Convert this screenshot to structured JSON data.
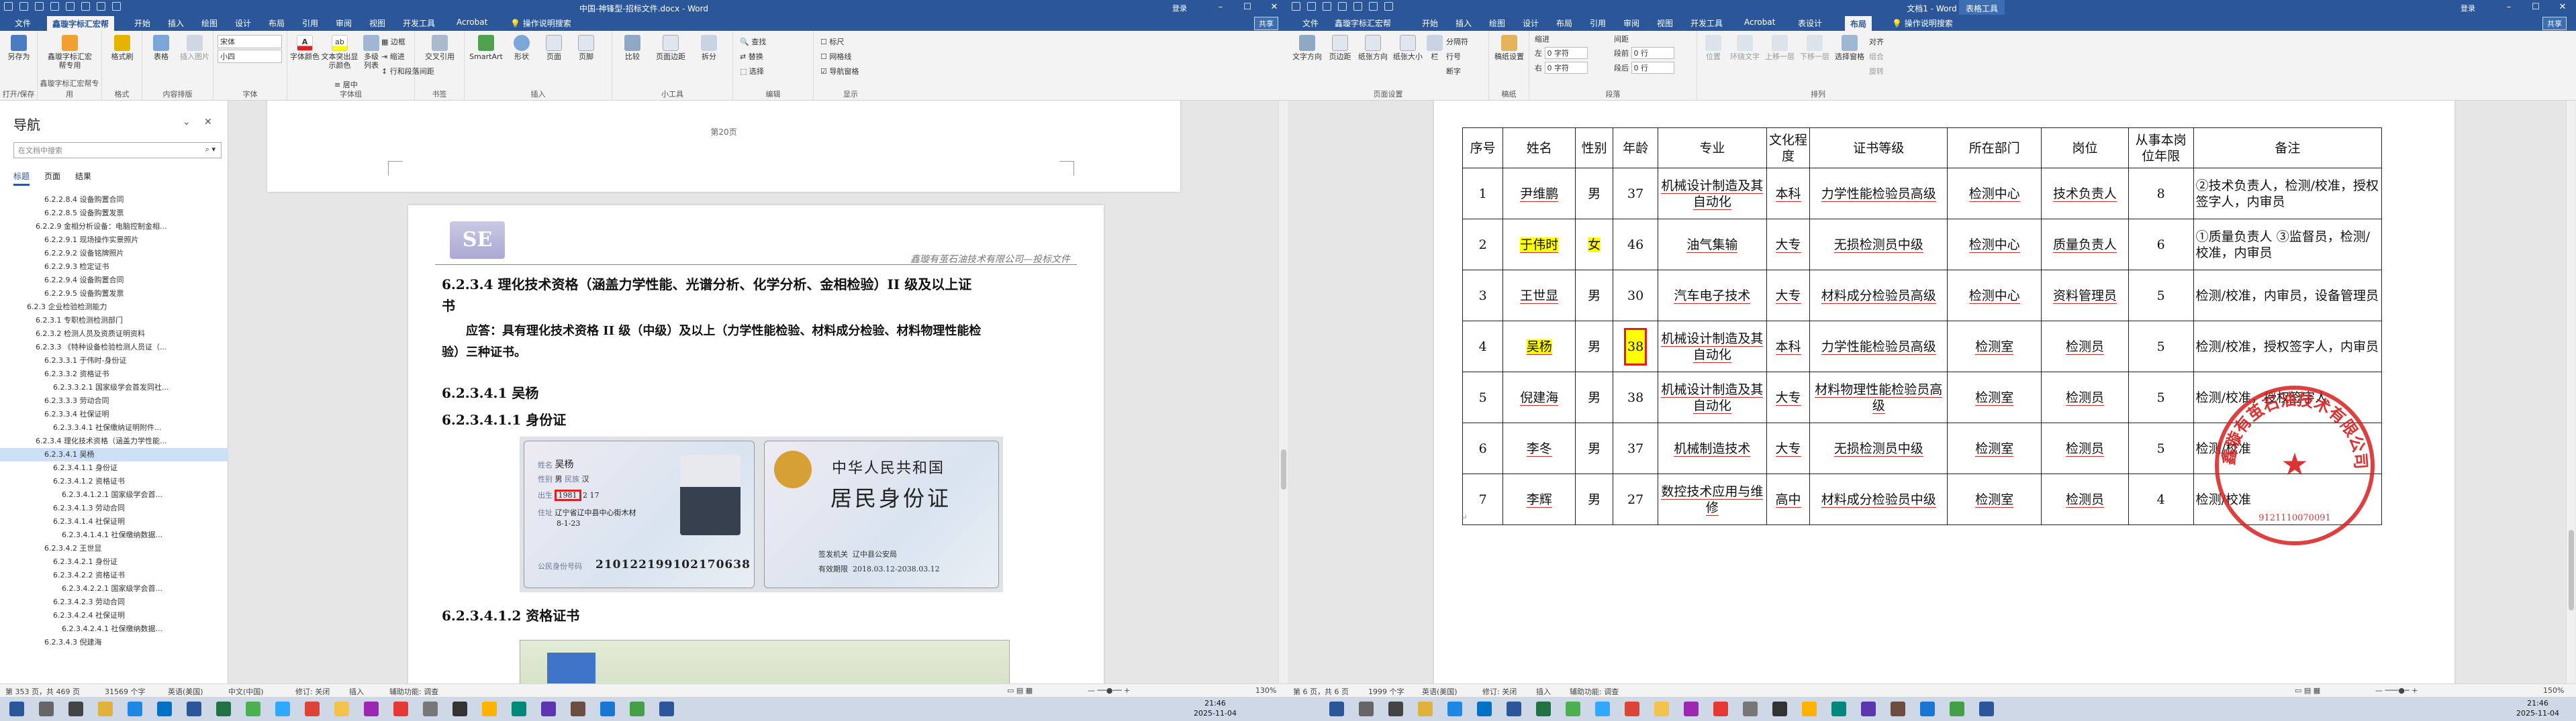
{
  "left_window": {
    "title": "中国-神锋型-招标文件.docx - Word",
    "account": "登录",
    "quick_access": [
      "save-icon",
      "undo-icon",
      "redo-icon",
      "print-icon",
      "touch-icon",
      "format-icon",
      "list-icon",
      "customize-icon"
    ],
    "tabs": [
      "文件",
      "鑫璇字标汇宏帮",
      "开始",
      "插入",
      "绘图",
      "设计",
      "布局",
      "引用",
      "审阅",
      "视图",
      "开发工具",
      "Acrobat"
    ],
    "active_tab": "鑫璇字标汇宏帮",
    "tell_me": "操作说明搜索",
    "share": "共享",
    "ribbon": {
      "groups": [
        "打开/保存",
        "鑫璇字标汇宏帮专用",
        "格式",
        "内容排版",
        "字体",
        "字体组",
        "书签",
        "插入",
        "小工具",
        "编辑",
        "显示"
      ],
      "buttons": {
        "open_save": "另存为",
        "sync": "鑫璇字标汇宏帮专用",
        "format_brush": "格式刷",
        "table": "表格",
        "insert_image": "插入图片",
        "font_name": "宋体",
        "font_size": "小四",
        "font_color": "字体颜色",
        "text_highlight": "文本突出显示颜色",
        "char_spacing": "多级列表",
        "border": "边框",
        "indent": "缩进",
        "line_spacing": "行和段落间距",
        "align_center": "居中",
        "text_quote": "交叉引用",
        "smartart": "SmartArt",
        "shape": "形状",
        "page": "页面",
        "page_break": "页脚",
        "compare": "比较",
        "page_break2": "页面边距",
        "split": "拆分",
        "find": "查找",
        "replace": "替换",
        "select": "选择",
        "ruler": "标尺",
        "gridlines": "网格线",
        "nav_pane": "导航窗格"
      },
      "checks": {
        "ruler": false,
        "gridlines": false,
        "nav_pane": true
      }
    },
    "nav": {
      "title": "导航",
      "search_placeholder": "在文档中搜索",
      "tabs": [
        "标题",
        "页面",
        "结果"
      ],
      "items": [
        "6.2.2.8.4 设备购置合同",
        "6.2.2.8.5 设备购置发票",
        "6.2.2.9 金相分析设备：电脑控制金相...",
        "6.2.2.9.1 现场操作实景照片",
        "6.2.2.9.2 设备铭牌照片",
        "6.2.2.9.3 检定证书",
        "6.2.2.9.4 设备购置合同",
        "6.2.2.9.5 设备购置发票",
        "6.2.3 企业检验检测能力",
        "6.2.3.1 专职检测检测部门",
        "6.2.3.2 检测人员及资质证明资料",
        "6.2.3.3 《特种设备检验检测人员证（...",
        "6.2.3.3.1 于伟时-身份证",
        "6.2.3.3.2 资格证书",
        "6.2.3.3.2.1 国家级学会首发同社...",
        "6.2.3.3.3 劳动合同",
        "6.2.3.3.4 社保证明",
        "6.2.3.3.4.1 社保缴纳证明附件...",
        "6.2.3.4 理化技术资格（涵盖力学性能...",
        "6.2.3.4.1 吴杨",
        "6.2.3.4.1.1 身份证",
        "6.2.3.4.1.2 资格证书",
        "6.2.3.4.1.2.1 国家级学会首...",
        "6.2.3.4.1.3 劳动合同",
        "6.2.3.4.1.4 社保证明",
        "6.2.3.4.1.4.1 社保缴纳数据...",
        "6.2.3.4.2 王世显",
        "6.2.3.4.2.1 身份证",
        "6.2.3.4.2.2 资格证书",
        "6.2.3.4.2.2.1 国家级学会首...",
        "6.2.3.4.2.3 劳动合同",
        "6.2.3.4.2.4 社保证明",
        "6.2.3.4.2.4.1 社保缴纳数据...",
        "6.2.3.4.3 倪建海"
      ],
      "selected_index": 19
    },
    "page_top": {
      "page_number": "第20页"
    },
    "page": {
      "header_right": "鑫璇有茧石油技术有限公司—投标文件",
      "h1": "6.2.3.4 理化技术资格（涵盖力学性能、光谱分析、化学分析、金相检验）II 级及以上证书",
      "req": "应答：具有理化技术资格 II 级（中级）及以上（力学性能检验、材料成分检验、材料物理性能检验）三种证书。",
      "h2": "6.2.3.4.1 吴杨",
      "h3": "6.2.3.4.1.1 身份证",
      "h4": "6.2.3.4.1.2 资格证书",
      "id_front": {
        "name_label": "姓名",
        "name": "吴杨",
        "gender_label": "性别",
        "gender": "男",
        "ethnic_label": "民族",
        "ethnic": "汉",
        "birth_label": "出生",
        "year": "1981",
        "month": "2",
        "day": "17",
        "address_label": "住址",
        "address": "辽宁省辽中县中心街木材",
        "address2": "8-1-23",
        "id_label": "公民身份号码",
        "id_number": "210122199102170638"
      },
      "id_back": {
        "line1": "中华人民共和国",
        "line2": "居民身份证",
        "issuer_label": "签发机关",
        "issuer": "辽中县公安局",
        "valid_label": "有效期限",
        "valid": "2018.03.12-2038.03.12"
      }
    },
    "status": {
      "page": "第 353 页，共 469 页",
      "words": "31569 个字",
      "lang": "英语(美国)",
      "input": "中文(中国)",
      "track": "修订: 关闭",
      "mode": "插入",
      "access": "辅助功能: 调查",
      "zoom": "130%"
    }
  },
  "right_window": {
    "title": "文档1 - Word",
    "context_tab": "表格工具",
    "account": "登录",
    "tabs": [
      "文件",
      "鑫璇字标汇宏帮",
      "开始",
      "插入",
      "绘图",
      "设计",
      "布局",
      "引用",
      "审阅",
      "视图",
      "开发工具",
      "Acrobat",
      "表设计",
      "布局"
    ],
    "active_tab": "布局",
    "tell_me": "操作说明搜索",
    "share": "共享",
    "ribbon": {
      "groups": [
        "页面设置",
        "稿纸",
        "段落",
        "排列"
      ],
      "buttons": {
        "text_dir": "文字方向",
        "margins": "页边距",
        "orientation": "纸张方向",
        "size": "纸张大小",
        "columns": "栏",
        "breaks": "分隔符",
        "line_num": "行号",
        "hyphen": "断字",
        "paper": "稿纸设置",
        "position": "位置",
        "wrap": "环绕文字",
        "forward": "上移一层",
        "backward": "下移一层",
        "pane": "选择窗格",
        "align": "对齐",
        "group": "组合",
        "rotate": "旋转"
      },
      "indent": {
        "label": "缩进",
        "left_label": "左",
        "left": "0 字符",
        "right_label": "右",
        "right": "0 字符"
      },
      "spacing": {
        "label": "间距",
        "before_label": "段前",
        "before": "0 行",
        "after_label": "段后",
        "after": "0 行"
      }
    },
    "table": {
      "headers": [
        "序号",
        "姓名",
        "性别",
        "年龄",
        "专业",
        "文化程度",
        "证书等级",
        "所在部门",
        "岗位",
        "从事本岗位年限",
        "备注"
      ],
      "rows": [
        [
          "1",
          "尹维鹏",
          "男",
          "37",
          "机械设计制造及其自动化",
          "本科",
          "力学性能检验员高级",
          "检测中心",
          "技术负责人",
          "8",
          "②技术负责人，检测/校准，授权签字人，内审员"
        ],
        [
          "2",
          "于伟时",
          "女",
          "46",
          "油气集输",
          "大专",
          "无损检测员中级",
          "检测中心",
          "质量负责人",
          "6",
          "①质量负责人 ③监督员，检测/校准，内审员"
        ],
        [
          "3",
          "王世显",
          "男",
          "30",
          "汽车电子技术",
          "大专",
          "材料成分检验员高级",
          "检测中心",
          "资料管理员",
          "5",
          "检测/校准，内审员，设备管理员"
        ],
        [
          "4",
          "吴杨",
          "男",
          "38",
          "机械设计制造及其自动化",
          "本科",
          "力学性能检验员高级",
          "检测室",
          "检测员",
          "5",
          "检测/校准，授权签字人，内审员"
        ],
        [
          "5",
          "倪建海",
          "男",
          "38",
          "机械设计制造及其自动化",
          "大专",
          "材料物理性能检验员高级",
          "检测室",
          "检测员",
          "5",
          "检测/校准，授权签字人"
        ],
        [
          "6",
          "李冬",
          "男",
          "37",
          "机械制造技术",
          "大专",
          "无损检测员中级",
          "检测室",
          "检测员",
          "5",
          "检测/校准"
        ],
        [
          "7",
          "李辉",
          "男",
          "27",
          "数控技术应用与维修",
          "高中",
          "材料成分检验员中级",
          "检测室",
          "检测员",
          "4",
          "检测/校准"
        ]
      ]
    },
    "seal": {
      "text": "鑫璇有茧石油技术有限公司",
      "code": "9121110070091"
    },
    "status": {
      "page": "第 6 页，共 6 页",
      "words": "1999 个字",
      "lang": "英语(美国)",
      "track": "修订: 关闭",
      "mode": "插入",
      "access": "辅助功能: 调查",
      "zoom": "150%"
    }
  },
  "taskbar": {
    "left_clock": {
      "time": "21:46",
      "date": "2025-11-04"
    },
    "right_clock": {
      "time": "21:46",
      "date": "2025-11-04"
    }
  },
  "colors": {
    "word_blue": "#2b579a",
    "highlight": "#ffff00",
    "red_box": "#e02020",
    "seal_red": "#d81e1e"
  }
}
